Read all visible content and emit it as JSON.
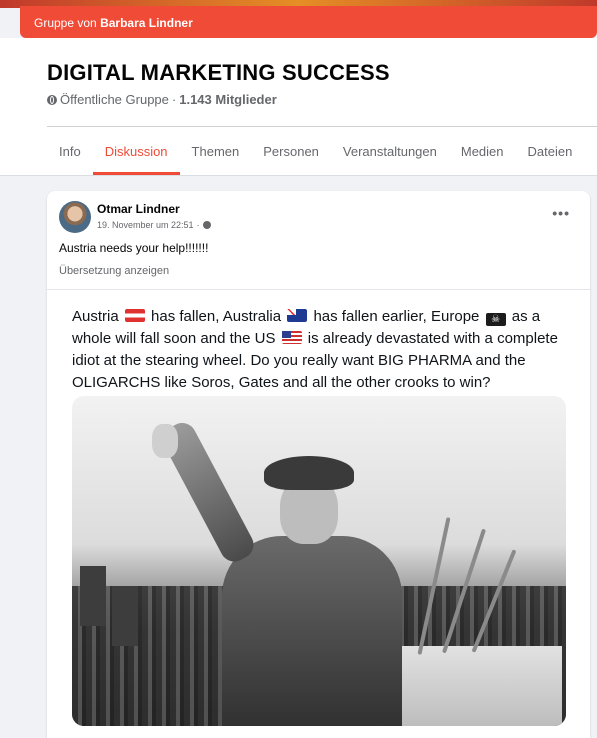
{
  "group_bar": {
    "prefix": "Gruppe von",
    "owner": "Barbara Lindner"
  },
  "group": {
    "title": "DIGITAL MARKETING SUCCESS",
    "privacy": "Öffentliche Gruppe",
    "separator": "·",
    "members": "1.143 Mitglieder"
  },
  "tabs": [
    {
      "label": "Info"
    },
    {
      "label": "Diskussion",
      "active": true
    },
    {
      "label": "Themen"
    },
    {
      "label": "Personen"
    },
    {
      "label": "Veranstaltungen"
    },
    {
      "label": "Medien"
    },
    {
      "label": "Dateien"
    }
  ],
  "post": {
    "author": "Otmar Lindner",
    "time": "19. November um 22:51",
    "separator": "·",
    "more": "•••",
    "text": "Austria needs your help!!!!!!!",
    "translate": "Übersetzung anzeigen",
    "meme": {
      "t1": "Austria",
      "t2": "has fallen, Australia",
      "t3": "has fallen earlier, Europe",
      "t4": "as a whole will fall soon and the US",
      "t5": "is already devastated with a complete idiot at the stearing wheel. Do you really want BIG PHARMA and the OLIGARCHS like Soros, Gates and all the other crooks to win?",
      "eu_flag_symbol": "☠"
    }
  },
  "colors": {
    "accent": "#ef4b37",
    "muted": "#65676b",
    "bg": "#f0f2f5"
  },
  "icons": [
    "globe-icon",
    "more-options-icon",
    "flag-austria-icon",
    "flag-australia-icon",
    "flag-pirate-icon",
    "flag-us-icon"
  ]
}
